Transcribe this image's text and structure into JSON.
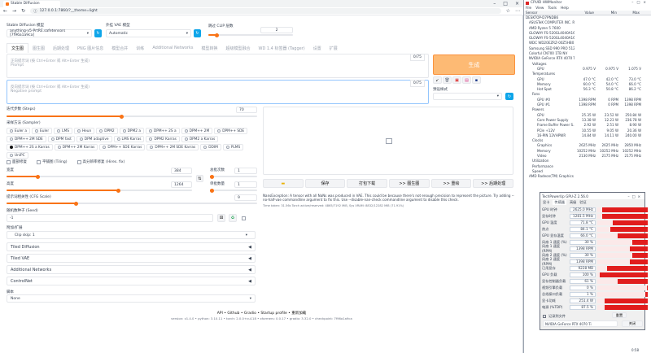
{
  "browser": {
    "tab_title": "Stable Diffusion",
    "url": "127.0.0.1:7860/?__theme=light"
  },
  "sd": {
    "model_label": "Stable Diffusion 模型",
    "model_value": "anything-v5-PrtRE.safetensors [7f96a1a9ca]",
    "vae_label": "外挂 VAE 模型",
    "vae_value": "Automatic",
    "clip_label": "跳过 CLIP 层数",
    "clip_value": "2",
    "tabs": [
      "文生图",
      "图生图",
      "后期处理",
      "PNG 图片信息",
      "模型合并",
      "训练",
      "Additional Networks",
      "模型转换",
      "超级模型融合",
      "WD 1.4 标签器 (Tagger)",
      "设置",
      "扩展"
    ],
    "prompt_placeholder": "正向提示词 (按 Ctrl+Enter 或 Alt+Enter 生成)",
    "prompt_sub": "Prompt",
    "prompt_count": "0/75",
    "neg_placeholder": "反向提示词 (按 Ctrl+Enter 或 Alt+Enter 生成)",
    "neg_sub": "Negative prompt",
    "neg_count": "0/75",
    "generate": "生成",
    "style_label": "预设样式",
    "steps_label": "迭代步数 (Steps)",
    "steps_value": "70",
    "sampler_label": "采样方法 (Sampler)",
    "samplers": [
      "Euler a",
      "Euler",
      "LMS",
      "Heun",
      "DPM2",
      "DPM2 a",
      "DPM++ 2S a",
      "DPM++ 2M",
      "DPM++ SDE",
      "DPM++ 2M SDE",
      "DPM fast",
      "DPM adaptive",
      "LMS Karras",
      "DPM2 Karras",
      "DPM2 a Karras",
      "DPM++ 2S a Karras",
      "DPM++ 2M Karras",
      "DPM++ SDE Karras",
      "DPM++ 2M SDE Karras",
      "DDIM",
      "PLMS",
      "UniPC"
    ],
    "selected_sampler": "DPM++ 2S a Karras",
    "checks": [
      "面部修复",
      "平铺图 (Tiling)",
      "高分辨率修复 (Hires. fix)"
    ],
    "width_label": "宽度",
    "width_value": "384",
    "height_label": "高度",
    "height_value": "1264",
    "batch_count_label": "总批次数",
    "batch_count_value": "1",
    "batch_size_label": "单批数量",
    "batch_size_value": "1",
    "cfg_label": "提示词相关性 (CFG Scale)",
    "cfg_value": "9",
    "seed_label": "随机数种子 (Seed)",
    "seed_value": "-1",
    "script_extra_label": "附加/扩展",
    "clip_skip_value": "Clip skip: 1",
    "accordions": [
      "Tiled Diffusion",
      "Tiled VAE",
      "Additional Networks",
      "ControlNet"
    ],
    "script_label": "脚本",
    "script_value": "None",
    "actions": [
      "保存",
      "打包下载",
      ">> 图生图",
      ">> 重绘",
      ">> 后期处理"
    ],
    "error_text": "NansException: A tensor with all NaNs was produced in VAE. This could be because there's not enough precision to represent the picture. Try adding --no-half-vae commandline argument to fix this. Use --disable-nan-check commandline argument to disable this check.",
    "time_text": "Time taken: 31.56s  Torch active/reserved: 4865/7192 MiB, Sys VRAM: 8832/12282 MiB (71.91%)",
    "footer_links": "API  •  Github  •  Gradio  •  Startup profile  •  重新加载",
    "footer_versions": "version: v1.4.0  •  python: 3.10.11  •  torch: 2.0.0+cu118  •  xformers: 0.0.17  •  gradio: 3.32.0  •  checkpoint: 7f96a1a9ca"
  },
  "hwmon": {
    "title": "CPUID HWMonitor",
    "menu": [
      "File",
      "View",
      "Tools",
      "Help"
    ],
    "columns": [
      "Sensor",
      "Value",
      "Min",
      "Max"
    ],
    "rows": [
      [
        "DESKTOP-D7PNDB6",
        "",
        "",
        ""
      ],
      [
        "ASUSTeK COMPUTER INC. R...",
        "",
        "",
        ""
      ],
      [
        "AMD Ryzen 5 7600",
        "",
        "",
        ""
      ],
      [
        "GLOWAY FS-520GL4040A16G",
        "",
        "",
        ""
      ],
      [
        "GLOWAY FS-520GL4040A16G",
        "",
        "",
        ""
      ],
      [
        "WDC WD20EZRZ-00Z5HB0",
        "",
        "",
        ""
      ],
      [
        "Samsung SSD 990 PRO 512...",
        "",
        "",
        ""
      ],
      [
        "Colorful CN700 1TB NV",
        "",
        "",
        ""
      ],
      [
        "NVIDIA GeForce RTX 4070 Ti",
        "",
        "",
        ""
      ],
      [
        "Voltages",
        "",
        "",
        ""
      ],
      [
        "GPU",
        "0.975 V",
        "0.975 V",
        "1.075 V"
      ],
      [
        "Temperatures",
        "",
        "",
        ""
      ],
      [
        "GPU",
        "47.0 °C",
        "42.0 °C",
        "73.0 °C"
      ],
      [
        "Memory",
        "60.0 °C",
        "54.0 °C",
        "66.0 °C"
      ],
      [
        "Hot Spot",
        "56.3 °C",
        "50.8 °C",
        "86.2 °C"
      ],
      [
        "Fans",
        "",
        "",
        ""
      ],
      [
        "GPU #0",
        "1398 RPM",
        "0 RPM",
        "1398 RPM"
      ],
      [
        "GPU #1",
        "1398 RPM",
        "0 RPM",
        "1398 RPM"
      ],
      [
        "Powers",
        "",
        "",
        ""
      ],
      [
        "GPU",
        "25.35 W",
        "23.52 W",
        "250.84 W"
      ],
      [
        "Core Power Supply",
        "13.38 W",
        "12.23 W",
        "236.78 W"
      ],
      [
        "Frame Buffer Power S...",
        "2.92 W",
        "2.51 W",
        "8.90 W"
      ],
      [
        "PCIe +12V",
        "10.55 W",
        "9.05 W",
        "20.36 W"
      ],
      [
        "16-PIN 12VHPWR",
        "14.84 W",
        "14.11 W",
        "240.00 W"
      ],
      [
        "Clocks",
        "",
        "",
        ""
      ],
      [
        "Graphics",
        "2625 MHz",
        "2625 MHz",
        "2850 MHz"
      ],
      [
        "Memory",
        "10252 MHz",
        "10252 MHz",
        "10252 MHz"
      ],
      [
        "Video",
        "2130 MHz",
        "2175 MHz",
        "2175 MHz"
      ],
      [
        "Utilization",
        "",
        "",
        ""
      ],
      [
        "Performance",
        "",
        "",
        ""
      ],
      [
        "Speed",
        "",
        "",
        ""
      ],
      [
        "AMD Radeon(TM) Graphics",
        "",
        "",
        ""
      ]
    ]
  },
  "speedfan": {
    "title": "TechPowerUp GPU-Z 2.56.0",
    "tabs": [
      "显卡",
      "传感器",
      "高级",
      "验证"
    ],
    "rows": [
      [
        "GPU 时钟",
        "2625.0 MHz",
        0.9
      ],
      [
        "显存时钟",
        "1281.5 MHz",
        0.9
      ],
      [
        "GPU 温度",
        "71.8 °C",
        0.7
      ],
      [
        "热点",
        "84.1 °C",
        0.75
      ],
      [
        "GPU 显存温度",
        "66.0 °C",
        0.6
      ],
      [
        "风扇 1 速度 (%)",
        "30 %",
        0.3
      ],
      [
        "风扇 1 速度 (RPM)",
        "1398 RPM",
        0.35
      ],
      [
        "风扇 2 速度 (%)",
        "30 %",
        0.3
      ],
      [
        "风扇 2 速度 (RPM)",
        "1398 RPM",
        0.35
      ],
      [
        "已用显存",
        "9228 MB",
        0.8
      ],
      [
        "GPU 负载",
        "100 %",
        0.95
      ],
      [
        "显存控制器负载",
        "61 %",
        0.6
      ],
      [
        "视频引擎负载",
        "0 %",
        0.02
      ],
      [
        "总线接口负载",
        "1 %",
        0.05
      ],
      [
        "显卡功耗",
        "251.4 W",
        0.85
      ],
      [
        "电源 (%TDP)",
        "87.5 %",
        0.85
      ]
    ],
    "log": "记录到文件",
    "reset": "重置",
    "close": "关闭",
    "gpu": "NVIDIA GeForce RTX 4070 Ti"
  },
  "taskbar": {
    "time": "0:58"
  }
}
